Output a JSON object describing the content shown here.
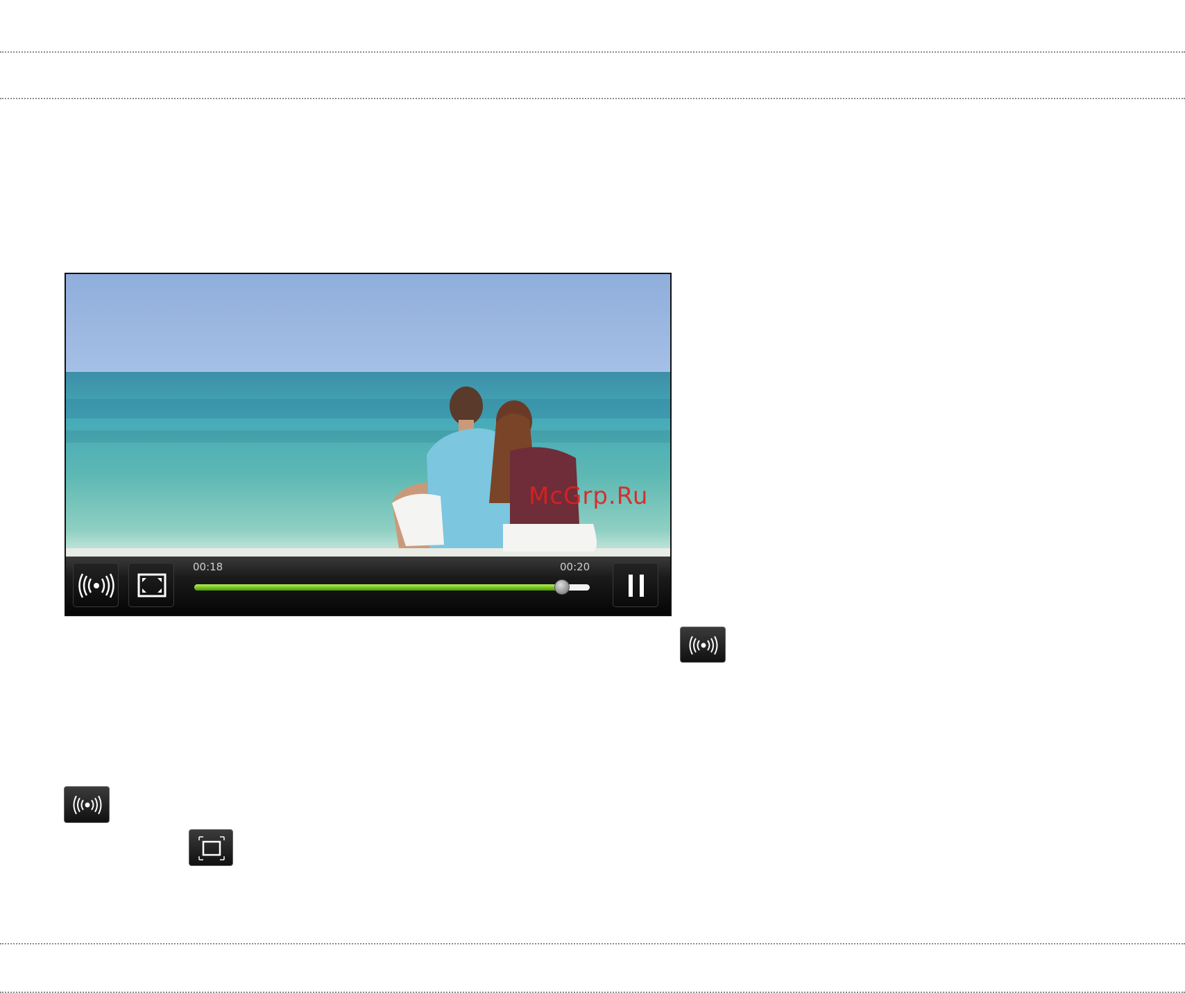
{
  "player": {
    "current_time": "00:18",
    "total_time": "00:20",
    "progress_fraction": 0.93,
    "watermark": "McGrp.Ru"
  },
  "icons": {
    "broadcast": "broadcast-icon",
    "fullscreen": "fullscreen-icon",
    "pause": "pause-icon",
    "screen_mode": "screen-mode-icon"
  },
  "colors": {
    "progress_fill": "#7ccc22",
    "track": "#f2f2f2",
    "watermark": "#e02020"
  }
}
